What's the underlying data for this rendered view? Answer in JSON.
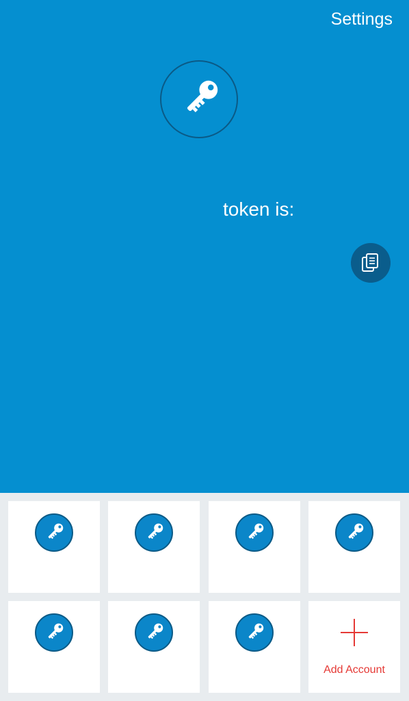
{
  "header": {
    "settings_label": "Settings",
    "hero_icon": "key-icon"
  },
  "token": {
    "label": "token is:",
    "value": "",
    "copy_icon": "copy-icon"
  },
  "accounts": [
    {
      "icon": "key-icon",
      "name": ""
    },
    {
      "icon": "key-icon",
      "name": ""
    },
    {
      "icon": "key-icon",
      "name": ""
    },
    {
      "icon": "key-icon",
      "name": ""
    },
    {
      "icon": "key-icon",
      "name": ""
    },
    {
      "icon": "key-icon",
      "name": ""
    },
    {
      "icon": "key-icon",
      "name": ""
    }
  ],
  "add_account": {
    "icon": "plus-icon",
    "label": "Add Account"
  },
  "colors": {
    "primary_blue": "#058fd0",
    "dark_blue": "#0a5d8c",
    "accent_red": "#e53935",
    "grid_bg": "#e8ecef"
  }
}
